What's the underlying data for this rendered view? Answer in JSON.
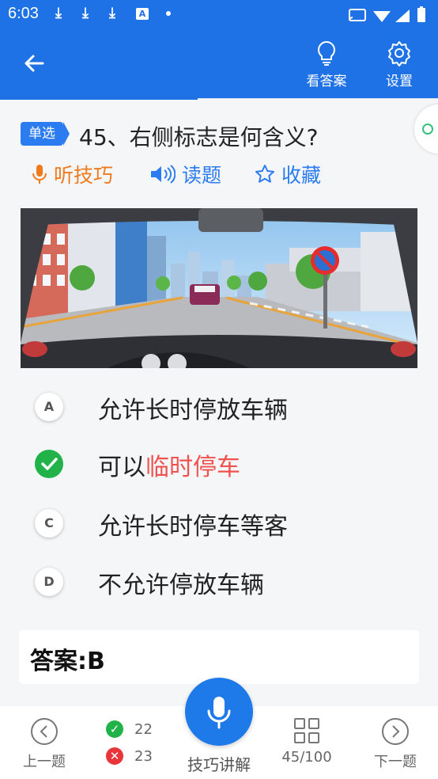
{
  "status_bar": {
    "time": "6:03",
    "a_icon": "A"
  },
  "app_bar": {
    "actions": [
      {
        "label": "看答案",
        "icon": "lightbulb-icon"
      },
      {
        "label": "设置",
        "icon": "gear-icon"
      }
    ]
  },
  "question": {
    "type_badge": "单选",
    "text": "45、右侧标志是何含义?"
  },
  "tools": [
    {
      "label": "听技巧",
      "icon": "microphone-icon",
      "color": "#f07a1e"
    },
    {
      "label": "读题",
      "icon": "speaker-icon",
      "color": "#2b7cf0"
    },
    {
      "label": "收藏",
      "icon": "star-outline-icon",
      "color": "#2b7cf0"
    }
  ],
  "options": [
    {
      "letter": "A",
      "text": "允许长时停放车辆",
      "state": "normal"
    },
    {
      "letter": "B",
      "text_plain": "可以",
      "text_highlight": "临时停车",
      "state": "correct"
    },
    {
      "letter": "C",
      "text": "允许长时停车等客",
      "state": "normal"
    },
    {
      "letter": "D",
      "text": "不允许停放车辆",
      "state": "normal"
    }
  ],
  "answer": {
    "text": "答案:B"
  },
  "bottom_bar": {
    "prev": "上一题",
    "correct_count": "22",
    "wrong_count": "23",
    "mic_label": "技巧讲解",
    "progress": "45/100",
    "next": "下一题"
  },
  "colors": {
    "primary": "#1f72e5",
    "correct": "#21b34a",
    "wrong": "#e8353b",
    "highlight": "#f0534f",
    "orange": "#f07a1e"
  }
}
